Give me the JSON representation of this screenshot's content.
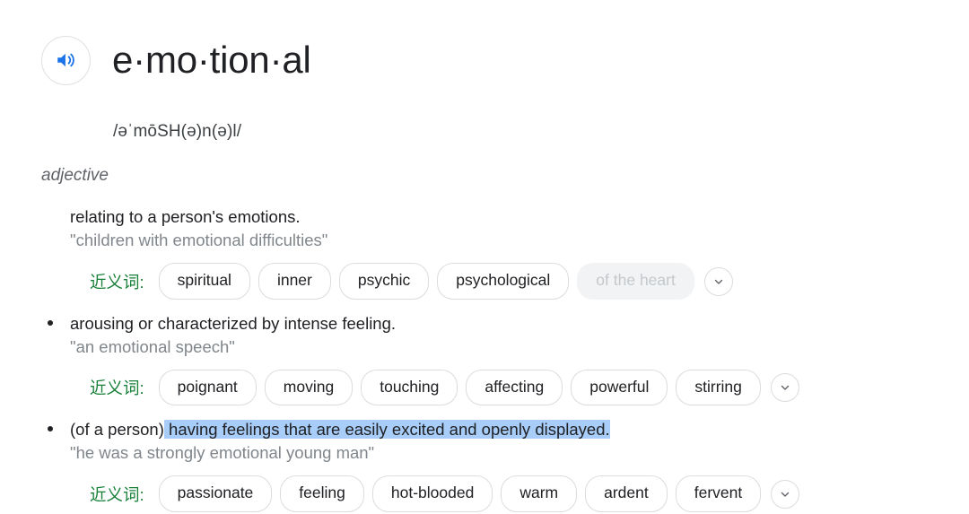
{
  "entry": {
    "headword": "e·mo·tion·al",
    "phonetic": "/əˈmōSH(ə)n(ə)l/",
    "part_of_speech": "adjective",
    "speaker_icon": "speaker-icon",
    "chevron_icon": "chevron-down-icon"
  },
  "colors": {
    "synonym_label_green": "#188038",
    "speaker_blue": "#1a73e8",
    "selection_highlight": "#a8cdf8",
    "example_grey": "#80868b",
    "chip_border": "#dadce0",
    "faded_chip_bg": "#f1f3f4"
  },
  "senses": [
    {
      "bullet": false,
      "definition_prefix": "",
      "definition": "relating to a person's emotions.",
      "definition_highlighted": "",
      "example": "\"children with emotional difficulties\"",
      "synonyms": {
        "label": "近义词:",
        "chips": [
          {
            "text": "spiritual",
            "faded": false
          },
          {
            "text": "inner",
            "faded": false
          },
          {
            "text": "psychic",
            "faded": false
          },
          {
            "text": "psychological",
            "faded": false
          },
          {
            "text": "of the heart",
            "faded": true
          }
        ],
        "more_label": "⌄"
      }
    },
    {
      "bullet": true,
      "definition_prefix": "",
      "definition": "arousing or characterized by intense feeling.",
      "definition_highlighted": "",
      "example": "\"an emotional speech\"",
      "synonyms": {
        "label": "近义词:",
        "chips": [
          {
            "text": "poignant",
            "faded": false
          },
          {
            "text": "moving",
            "faded": false
          },
          {
            "text": "touching",
            "faded": false
          },
          {
            "text": "affecting",
            "faded": false
          },
          {
            "text": "powerful",
            "faded": false
          },
          {
            "text": "stirring",
            "faded": false
          }
        ],
        "more_label": "⌄"
      }
    },
    {
      "bullet": true,
      "definition_prefix": "(of a person)",
      "definition": "",
      "definition_highlighted": " having feelings that are easily excited and openly displayed.",
      "example": "\"he was a strongly emotional young man\"",
      "synonyms": {
        "label": "近义词:",
        "chips": [
          {
            "text": "passionate",
            "faded": false
          },
          {
            "text": "feeling",
            "faded": false
          },
          {
            "text": "hot-blooded",
            "faded": false
          },
          {
            "text": "warm",
            "faded": false
          },
          {
            "text": "ardent",
            "faded": false
          },
          {
            "text": "fervent",
            "faded": false
          }
        ],
        "more_label": "⌄"
      }
    }
  ]
}
